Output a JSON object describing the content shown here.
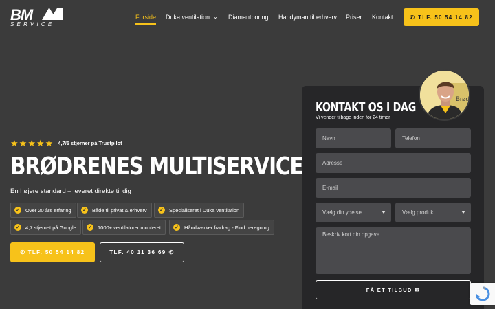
{
  "logo": {
    "main": "BM",
    "sub": "SERVICE"
  },
  "nav": {
    "items": [
      {
        "label": "Forside",
        "active": true
      },
      {
        "label": "Duka ventilation",
        "dropdown": true
      },
      {
        "label": "Diamantboring"
      },
      {
        "label": "Handyman til erhverv"
      },
      {
        "label": "Priser"
      },
      {
        "label": "Kontakt"
      }
    ],
    "cta_label": "TLF. 50 54 14 82"
  },
  "hero": {
    "rating_text": "4,7/5 stjerner på Trustpilot",
    "stars": 5,
    "title": "BRØDRENES MULTISERVICE",
    "subtitle": "En højere standard – leveret direkte til dig",
    "badges": [
      "Over 20 års erfaring",
      "Både til privat & erhverv",
      "Specialiseret i Duka ventilation",
      "4,7 stjernet på Google",
      "1000+ ventilatorer monteret",
      "Håndværker fradrag - Find beregning"
    ],
    "primary_button": "TLF. 50 54 14 82",
    "secondary_button": "TLF. 40 11 36 69"
  },
  "contact": {
    "title": "KONTAKT OS I DAG",
    "subtitle": "Vi vender tilbage inden for 24 timer",
    "fields": {
      "name": "Navn",
      "phone": "Telefon",
      "address": "Adresse",
      "email": "E-mail",
      "service": "Vælg din ydelse",
      "product": "Vælg produkt",
      "description": "Beskriv kort din opgave"
    },
    "submit_label": "FÅ ET TILBUD",
    "avatar_text": "Brød"
  },
  "colors": {
    "accent": "#f7c21a",
    "background": "#3b3b3b",
    "card": "#262628",
    "field": "#4a4a4d"
  }
}
